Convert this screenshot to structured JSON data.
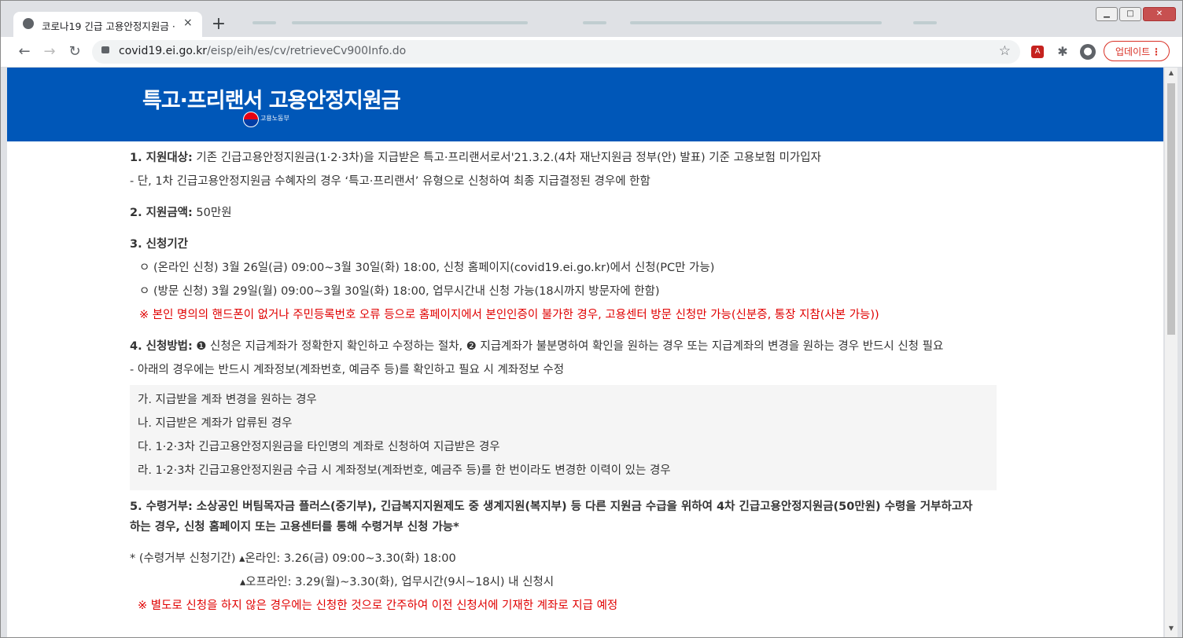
{
  "browser": {
    "tab_title": "코로나19 긴급 고용안정지원금 ·",
    "tab_close": "×",
    "new_tab": "+",
    "url_domain": "covid19.ei.go.kr",
    "url_path": "/eisp/eih/es/cv/retrieveCv900Info.do",
    "update_label": "업데이트",
    "update_menu": "⋮",
    "win_minimize": "▁",
    "win_maximize": "□",
    "win_close": "✕",
    "back": "←",
    "forward": "→",
    "reload": "↻",
    "star": "☆",
    "icons": [
      "pdf-icon",
      "extensions-icon",
      "profile-icon"
    ]
  },
  "banner": {
    "title": "특고·프리랜서 고용안정지원금",
    "ministry": "고용노동부"
  },
  "sections": {
    "s1_label": "1. 지원대상:",
    "s1_text": " 기존 긴급고용안정지원금(1·2·3차)을 지급받은 특고·프리랜서로서'21.3.2.(4차 재난지원금 정부(안) 발표) 기준 고용보험 미가입자",
    "s1_note": " - 단, 1차 긴급고용안정지원금 수혜자의 경우 ‘특고·프리랜서’ 유형으로 신청하여 최종 지급결정된 경우에 한함",
    "s2_label": "2. 지원금액:",
    "s2_text": " 50만원",
    "s3_label": "3. 신청기간",
    "s3_online": "ㅇ (온라인 신청) 3월 26일(금) 09:00~3월 30일(화) 18:00, 신청 홈페이지(covid19.ei.go.kr)에서 신청(PC만 가능)",
    "s3_visit": "ㅇ (방문 신청) 3월 29일(월) 09:00~3월 30일(화) 18:00, 업무시간내 신청 가능(18시까지 방문자에 한함)",
    "s3_warn": "※ 본인 명의의 핸드폰이 없거나 주민등록번호 오류 등으로 홈페이지에서 본인인증이 불가한 경우, 고용센터 방문 신청만 가능(신분증, 통장 지참(사본 가능))",
    "s4_label": "4. 신청방법:",
    "s4_text": " ❶ 신청은 지급계좌가 정확한지 확인하고 수정하는 절차, ❷ 지급계좌가 불분명하여 확인을 원하는 경우 또는 지급계좌의 변경을 원하는 경우 반드시 신청 필요",
    "s4_note": " - 아래의 경우에는 반드시 계좌정보(계좌번호, 예금주 등)를 확인하고 필요 시 계좌정보 수정",
    "s4_cases": [
      "가. 지급받을 계좌 변경을 원하는 경우",
      "나. 지급받은 계좌가 압류된 경우",
      "다. 1·2·3차 긴급고용안정지원금을 타인명의 계좌로 신청하여 지급받은 경우",
      "라. 1·2·3차 긴급고용안정지원금 수급 시 계좌정보(계좌번호, 예금주 등)를 한 번이라도 변경한 이력이 있는 경우"
    ],
    "s5_line1": "5. 수령거부: 소상공인 버팀목자금 플러스(중기부), 긴급복지지원제도 중 생계지원(복지부) 등 다른 지원금 수급을 위하여 4차 긴급고용안정지원금(50만원) 수령을 거부하고자",
    "s5_line2": "하는 경우, 신청 홈페이지 또는 고용센터를 통해 수령거부 신청 가능*",
    "s5_period_online": "* (수령거부 신청기간) ▴온라인: 3.26(금) 09:00~3.30(화) 18:00",
    "s5_period_offline": "▴오프라인: 3.29(월)~3.30(화), 업무시간(9시~18시) 내 신청시",
    "s5_warn": "※ 별도로 신청을 하지 않은 경우에는 신청한 것으로 간주하여 이전 신청서에 기재한 계좌로 지급 예정"
  }
}
